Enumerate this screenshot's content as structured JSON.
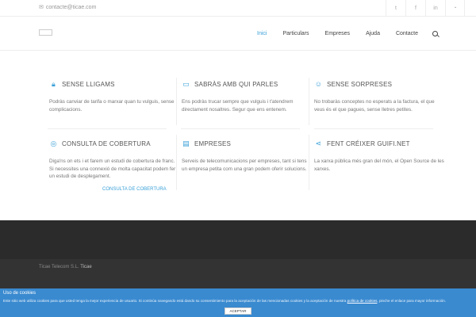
{
  "topbar": {
    "email": "contacte@ticae.com",
    "social": [
      "twitter-icon",
      "facebook-icon",
      "linkedin-icon",
      "rss-icon"
    ]
  },
  "nav": {
    "items": [
      "Inici",
      "Particulars",
      "Empreses",
      "Ajuda",
      "Contacte"
    ],
    "active": "Inici"
  },
  "features": [
    {
      "title": "SENSE LLIGAMS",
      "icon": "lock-icon",
      "text": "Podràs canviar de tarifa o marxar quan tu vulguis, sense complicacions."
    },
    {
      "title": "SABRÀS AMB QUI PARLES",
      "icon": "chat-icon",
      "text": "Ens podràs trucar sempre que vulguis i t'atendrem directament nosaltres. Segur que ens entenem."
    },
    {
      "title": "SENSE SORPRESES",
      "icon": "smile-icon",
      "text": "No trobaràs conceptes no esperats a la factura, el que veus és el que pagues, sense lletres petites."
    },
    {
      "title": "CONSULTA DE COBERTURA",
      "icon": "location-icon",
      "text": "Diga'ns on ets i et farem un estudi de cobertura de franc. Si necessites una connexió de molta capacitat podem fer un estudi de desplegament."
    },
    {
      "title": "EMPRESES",
      "icon": "building-icon",
      "text": "Serveis de telecomunicacions per empreses, tant si tens un empresa petita com una gran podem oferir solucions."
    },
    {
      "title": "FENT CRÉIXER GUIFI.NET",
      "icon": "share-icon",
      "text": "La xarxa pública més gran del món, el Open Source de les xarxes."
    }
  ],
  "coverage_button": "CONSULTA DE COBERTURA",
  "footer": {
    "copyright_prefix": "Ticae Telecom S.L.",
    "copyright_brand": "Ticae"
  },
  "cookie": {
    "title": "Uso de cookies",
    "text_before": "Este sitio web utiliza cookies para que usted tenga la mejor experiencia de usuario. Si continúa navegando está dando su consentimiento para la aceptación de las mencionadas cookies y la aceptación de nuestra ",
    "link": "política de cookies",
    "text_after": ", pinche el enlace para mayor información.",
    "accept": "ACEPTAR"
  },
  "colors": {
    "accent": "#3aa0d8",
    "cookie_bar": "#3a8ad0",
    "footer": "#2b2b2b"
  }
}
